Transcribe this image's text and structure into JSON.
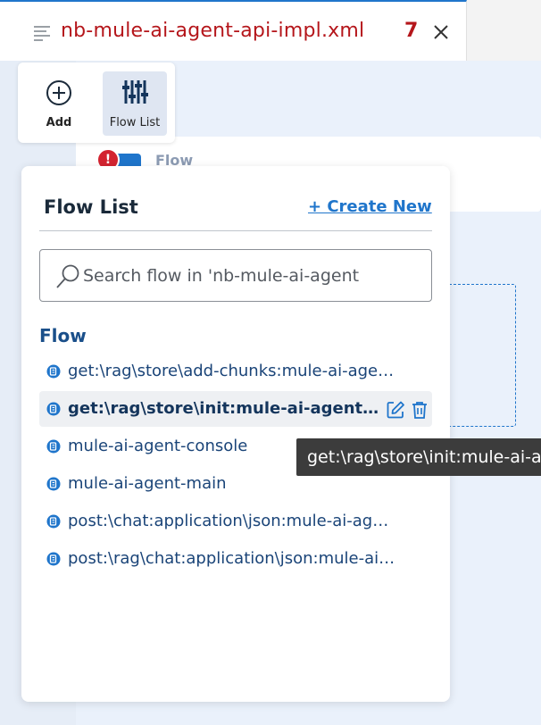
{
  "tab": {
    "title": "nb-mule-ai-agent-api-impl.xml",
    "problem_count": "7",
    "accent_color": "#b5161b"
  },
  "toolbar": {
    "add_label": "Add",
    "flow_list_label": "Flow List"
  },
  "canvas": {
    "card_label": "Flow",
    "error_badge": "!"
  },
  "panel": {
    "title": "Flow List",
    "create_new_label": "+ Create New",
    "search_placeholder": "Search flow in 'nb-mule-ai-agent",
    "search_value": "",
    "section_heading": "Flow",
    "flows": [
      {
        "label": "get:\\rag\\store\\add-chunks:mule-ai-agent-api-config",
        "selected": false
      },
      {
        "label": "get:\\rag\\store\\init:mule-ai-agent-api-config",
        "selected": true
      },
      {
        "label": "mule-ai-agent-console",
        "selected": false
      },
      {
        "label": "mule-ai-agent-main",
        "selected": false
      },
      {
        "label": "post:\\chat:application\\json:mule-ai-agent-api-config",
        "selected": false
      },
      {
        "label": "post:\\rag\\chat:application\\json:mule-ai-agent-api-config",
        "selected": false
      }
    ]
  },
  "tooltip": {
    "text": "get:\\rag\\store\\init:mule-ai-agent-api-config"
  },
  "colors": {
    "primary": "#1f75cb",
    "selected_row": "#eef0f3",
    "tooltip_bg": "#3c3c3c"
  }
}
